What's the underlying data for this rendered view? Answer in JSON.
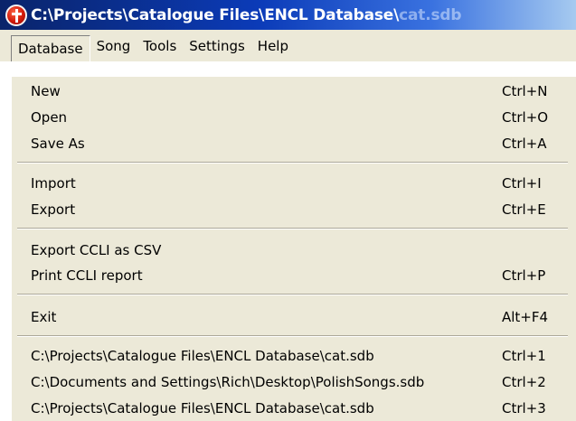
{
  "window": {
    "title_main": "C:\\Projects\\Catalogue Files\\ENCL Database\\",
    "title_faded": "cat.sdb"
  },
  "menubar": {
    "items": [
      {
        "label": "Database"
      },
      {
        "label": "Song"
      },
      {
        "label": "Tools"
      },
      {
        "label": "Settings"
      },
      {
        "label": "Help"
      }
    ]
  },
  "dropdown": {
    "items": [
      {
        "label": "New",
        "shortcut": "Ctrl+N"
      },
      {
        "label": "Open",
        "shortcut": "Ctrl+O"
      },
      {
        "label": "Save As",
        "shortcut": "Ctrl+A"
      },
      {
        "label": "Import",
        "shortcut": "Ctrl+I"
      },
      {
        "label": "Export",
        "shortcut": "Ctrl+E"
      },
      {
        "label": "Export CCLI as CSV",
        "shortcut": ""
      },
      {
        "label": "Print CCLI report",
        "shortcut": "Ctrl+P"
      },
      {
        "label": "Exit",
        "shortcut": "Alt+F4"
      },
      {
        "label": "C:\\Projects\\Catalogue Files\\ENCL Database\\cat.sdb",
        "shortcut": "Ctrl+1"
      },
      {
        "label": "C:\\Documents and Settings\\Rich\\Desktop\\PolishSongs.sdb",
        "shortcut": "Ctrl+2"
      },
      {
        "label": "C:\\Projects\\Catalogue Files\\ENCL Database\\cat.sdb",
        "shortcut": "Ctrl+3"
      }
    ]
  }
}
